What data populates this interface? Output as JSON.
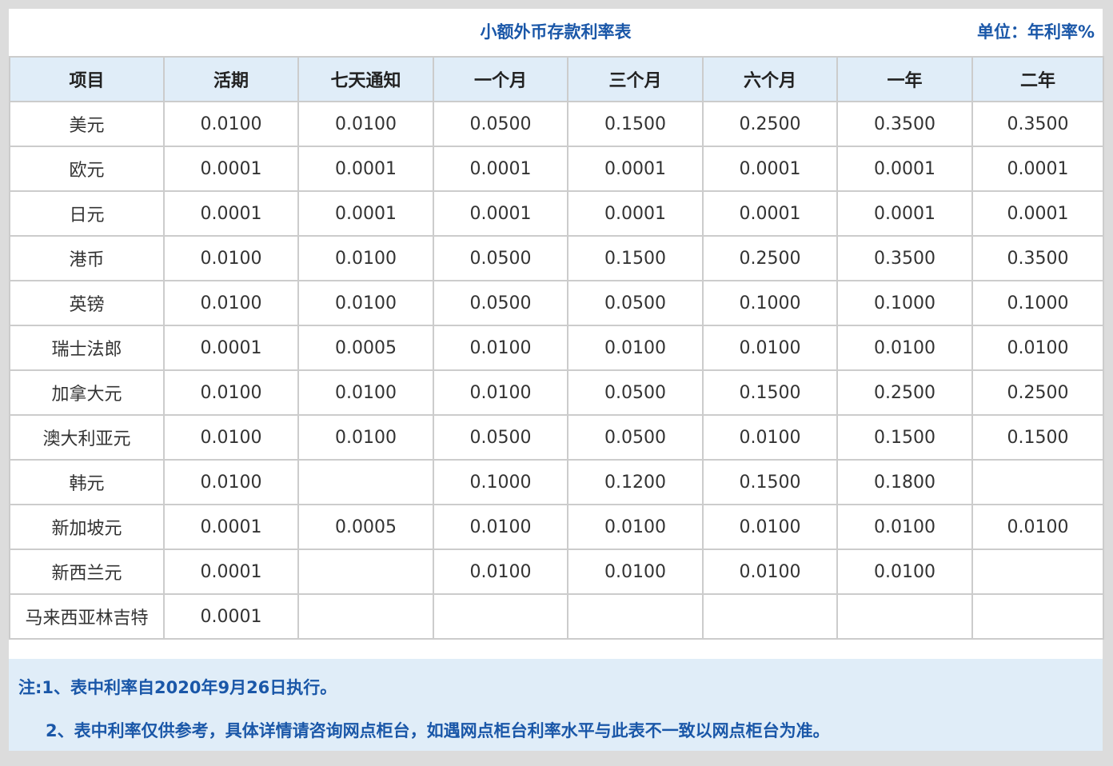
{
  "title": "小额外币存款利率表",
  "unit": "单位：年利率%",
  "columns": [
    "项目",
    "活期",
    "七天通知",
    "一个月",
    "三个月",
    "六个月",
    "一年",
    "二年"
  ],
  "rows": [
    {
      "name": "美元",
      "values": [
        "0.0100",
        "0.0100",
        "0.0500",
        "0.1500",
        "0.2500",
        "0.3500",
        "0.3500"
      ]
    },
    {
      "name": "欧元",
      "values": [
        "0.0001",
        "0.0001",
        "0.0001",
        "0.0001",
        "0.0001",
        "0.0001",
        "0.0001"
      ]
    },
    {
      "name": "日元",
      "values": [
        "0.0001",
        "0.0001",
        "0.0001",
        "0.0001",
        "0.0001",
        "0.0001",
        "0.0001"
      ]
    },
    {
      "name": "港币",
      "values": [
        "0.0100",
        "0.0100",
        "0.0500",
        "0.1500",
        "0.2500",
        "0.3500",
        "0.3500"
      ]
    },
    {
      "name": "英镑",
      "values": [
        "0.0100",
        "0.0100",
        "0.0500",
        "0.0500",
        "0.1000",
        "0.1000",
        "0.1000"
      ]
    },
    {
      "name": "瑞士法郎",
      "values": [
        "0.0001",
        "0.0005",
        "0.0100",
        "0.0100",
        "0.0100",
        "0.0100",
        "0.0100"
      ]
    },
    {
      "name": "加拿大元",
      "values": [
        "0.0100",
        "0.0100",
        "0.0100",
        "0.0500",
        "0.1500",
        "0.2500",
        "0.2500"
      ]
    },
    {
      "name": "澳大利亚元",
      "values": [
        "0.0100",
        "0.0100",
        "0.0500",
        "0.0500",
        "0.0100",
        "0.1500",
        "0.1500"
      ]
    },
    {
      "name": "韩元",
      "values": [
        "0.0100",
        "",
        "0.1000",
        "0.1200",
        "0.1500",
        "0.1800",
        ""
      ]
    },
    {
      "name": "新加坡元",
      "values": [
        "0.0001",
        "0.0005",
        "0.0100",
        "0.0100",
        "0.0100",
        "0.0100",
        "0.0100"
      ]
    },
    {
      "name": "新西兰元",
      "values": [
        "0.0001",
        "",
        "0.0100",
        "0.0100",
        "0.0100",
        "0.0100",
        ""
      ]
    },
    {
      "name": "马来西亚林吉特",
      "values": [
        "0.0001",
        "",
        "",
        "",
        "",
        "",
        ""
      ]
    }
  ],
  "notes": {
    "note1": "注:1、表中利率自2020年9月26日执行。",
    "note2": "2、表中利率仅供参考，具体详情请咨询网点柜台，如遇网点柜台利率水平与此表不一致以网点柜台为准。"
  }
}
